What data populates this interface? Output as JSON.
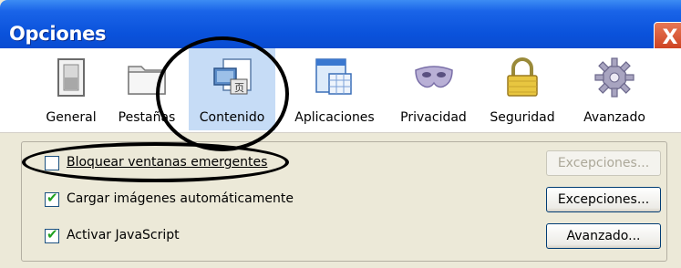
{
  "window": {
    "title": "Opciones",
    "close_label": "X"
  },
  "toolbar": {
    "items": [
      {
        "label": "General",
        "icon": "switch-icon"
      },
      {
        "label": "Pestañas",
        "icon": "folder-tabs-icon"
      },
      {
        "label": "Contenido",
        "icon": "content-page-icon",
        "selected": true
      },
      {
        "label": "Aplicaciones",
        "icon": "applications-icon"
      },
      {
        "label": "Privacidad",
        "icon": "mask-icon"
      },
      {
        "label": "Seguridad",
        "icon": "lock-icon"
      },
      {
        "label": "Avanzado",
        "icon": "gear-icon"
      }
    ]
  },
  "content": {
    "options": [
      {
        "label": "Bloquear ventanas emergentes",
        "checked": false,
        "button": "Excepciones...",
        "button_enabled": false
      },
      {
        "label": "Cargar imágenes automáticamente",
        "checked": true,
        "button": "Excepciones...",
        "button_enabled": true
      },
      {
        "label": "Activar JavaScript",
        "checked": true,
        "button": "Avanzado...",
        "button_enabled": true
      }
    ]
  },
  "colors": {
    "titlebar": "#0A52DB",
    "selected_tab": "#C6DCF6",
    "background": "#ECE9D8"
  }
}
